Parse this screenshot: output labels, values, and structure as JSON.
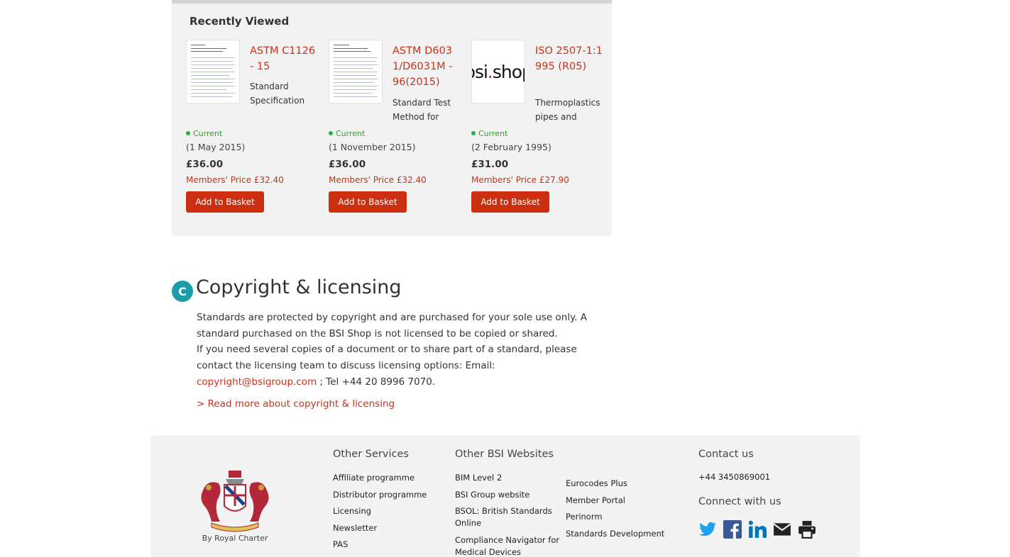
{
  "recently_viewed": {
    "title": "Recently Viewed",
    "items": [
      {
        "name": "ASTM C1126 - 15",
        "description": "Standard Specification for Faced or Unfaced",
        "status": "Current",
        "date": "(1 May 2015)",
        "price": "£36.00",
        "members_price": "Members' Price £32.40",
        "button": "Add to Basket"
      },
      {
        "name": "ASTM D6031/D6031M - 96(2015)",
        "description": "Standard Test Method for",
        "status": "Current",
        "date": "(1 November 2015)",
        "price": "£36.00",
        "members_price": "Members' Price £32.40",
        "button": "Add to Basket"
      },
      {
        "name": "ISO 2507-1:1995 (R05)",
        "description": "Thermoplastics pipes and",
        "status": "Current",
        "date": "(2 February 1995)",
        "price": "£31.00",
        "members_price": "Members' Price £27.90",
        "button": "Add to Basket",
        "thumb_logo": {
          "main": "bsi",
          "dot": ".",
          "rest": "shop"
        }
      }
    ]
  },
  "copyright": {
    "icon_letter": "C",
    "title": "Copyright & licensing",
    "para1": "Standards are protected by copyright and are purchased for your sole use only. A standard purchased on the BSI Shop is not licensed to be copied or shared.",
    "para2_pre": "If you need several copies of a document or to share part of a standard, please contact the licensing team to discuss licensing options: Email: ",
    "email": "copyright@bsigroup.com",
    "para2_post": " ; Tel +44 20 8996 7070.",
    "read_more": "> Read more about copyright & licensing"
  },
  "footer": {
    "crest_caption": "By Royal Charter",
    "other_services": {
      "heading": "Other Services",
      "links": [
        "Affiliate programme",
        "Distributor programme",
        "Licensing",
        "Newsletter",
        "PAS"
      ]
    },
    "other_websites": {
      "heading": "Other BSI Websites",
      "col1": [
        "BIM Level 2",
        "BSI Group website",
        "BSOL: British Standards Online",
        "Compliance Navigator for Medical Devices"
      ],
      "col2": [
        "Eurocodes Plus",
        "Member Portal",
        "Perinorm",
        "Standards Development"
      ]
    },
    "contact": {
      "heading": "Contact us",
      "phone": "+44 3450869001",
      "connect": "Connect with us",
      "social": [
        "twitter-icon",
        "facebook-icon",
        "linkedin-icon",
        "email-icon",
        "print-icon"
      ]
    }
  },
  "colors": {
    "accent_red": "#cc2f10",
    "link_red": "#c8331b",
    "status_green": "#24b148",
    "teal_icon": "#1b9eaa",
    "twitter": "#1da1f2",
    "facebook": "#3b5998",
    "linkedin": "#0077b5"
  }
}
